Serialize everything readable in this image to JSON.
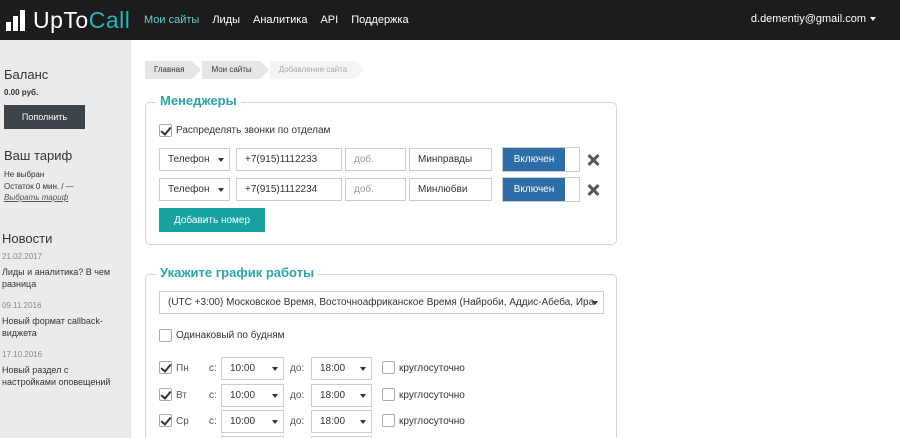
{
  "brand": {
    "logo_text_1": "UpTo",
    "logo_text_2": "Call"
  },
  "nav": {
    "items": [
      "Мои сайты",
      "Лиды",
      "Аналитика",
      "API",
      "Поддержка"
    ],
    "user_email": "d.dementiy@gmail.com"
  },
  "sidebar": {
    "balance_title": "Баланс",
    "balance_value": "0.00 руб.",
    "topup_label": "Пополнить",
    "tariff_title": "Ваш тариф",
    "tariff_status": "Не выбран",
    "tariff_remaining": "Остаток 0 мин. / —",
    "tariff_link": "Выбрать тариф",
    "news_title": "Новости",
    "news": [
      {
        "date": "21.02.2017",
        "title": "Лиды и аналитика? В чем разница"
      },
      {
        "date": "09.11.2016",
        "title": "Новый формат callback-виджета"
      },
      {
        "date": "17.10.2016",
        "title": "Новый раздел с настройками оповещений"
      }
    ]
  },
  "breadcrumb": [
    "Главная",
    "Мои сайты",
    "Добавление сайта"
  ],
  "managers": {
    "title": "Менеджеры",
    "distribute_label": "Распределять звонки по отделам",
    "distribute_checked": true,
    "rows": [
      {
        "type": "Телефон",
        "phone": "+7(915)1112233",
        "ext_placeholder": "доб.",
        "department": "Минправды",
        "status": "Включен"
      },
      {
        "type": "Телефон",
        "phone": "+7(915)1112234",
        "ext_placeholder": "доб.",
        "department": "Минлюбви",
        "status": "Включен"
      }
    ],
    "add_label": "Добавить номер"
  },
  "schedule": {
    "title": "Укажите график работы",
    "timezone": "(UTC +3:00) Московское Время, Восточноафриканское Время (Найроби, Аддис-Абеба, Ира",
    "same_weekdays_label": "Одинаковый по будням",
    "same_weekdays_checked": false,
    "from_label": "с:",
    "to_label": "до:",
    "allday_label": "круглосуточно",
    "days": [
      {
        "day": "Пн",
        "checked": true,
        "from": "10:00",
        "to": "18:00",
        "allday": false
      },
      {
        "day": "Вт",
        "checked": true,
        "from": "10:00",
        "to": "18:00",
        "allday": false
      },
      {
        "day": "Ср",
        "checked": true,
        "from": "10:00",
        "to": "18:00",
        "allday": false
      }
    ]
  }
}
